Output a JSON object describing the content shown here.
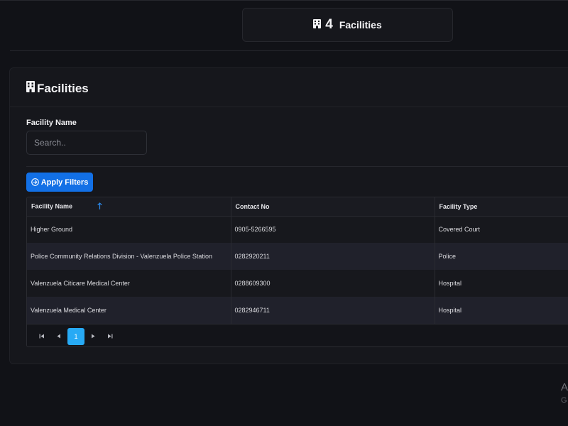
{
  "stat_card": {
    "count": "4",
    "label": "Facilities",
    "icon": "building-icon"
  },
  "panel": {
    "title": "Facilities",
    "icon": "building-icon"
  },
  "filters": {
    "facility_name_label": "Facility Name",
    "search_placeholder": "Search..",
    "search_value": "",
    "apply_label": "Apply Filters",
    "apply_icon": "arrow-circle-right-icon",
    "accent": "#1270e6"
  },
  "table": {
    "columns": [
      "Facility Name",
      "Contact No",
      "Facility Type"
    ],
    "sort": {
      "column": "Facility Name",
      "direction": "ascending"
    },
    "rows": [
      {
        "name": "Higher Ground",
        "contact": "0905-5266595",
        "type": "Covered Court"
      },
      {
        "name": "Police Community Relations Division - Valenzuela Police Station",
        "contact": "0282920211",
        "type": "Police"
      },
      {
        "name": "Valenzuela Citicare Medical Center",
        "contact": "0288609300",
        "type": "Hospital"
      },
      {
        "name": "Valenzuela Medical Center",
        "contact": "0282946711",
        "type": "Hospital"
      }
    ]
  },
  "pagination": {
    "current_page": "1",
    "first_icon": "first-page-icon",
    "prev_icon": "prev-page-icon",
    "next_icon": "next-page-icon",
    "last_icon": "last-page-icon",
    "active_color": "#27aaf5"
  },
  "watermark": {
    "line1": "A",
    "line2": "G"
  }
}
